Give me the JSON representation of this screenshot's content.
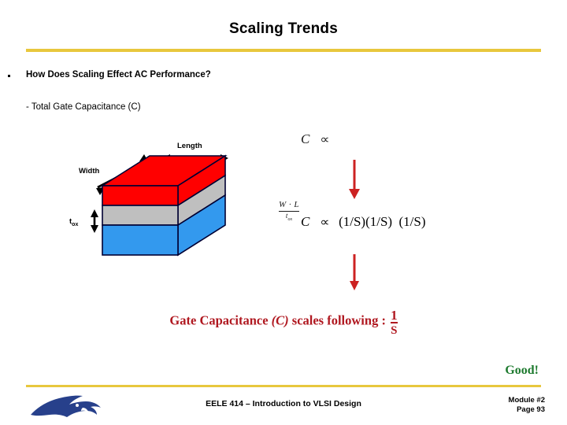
{
  "slide": {
    "title": "Scaling Trends",
    "accent_color": "#e8c73d",
    "background": "#ffffff"
  },
  "content": {
    "bullet": "How Does Scaling Effect AC Performance?",
    "sub_bullet": "- Total Gate Capacitance  (C)"
  },
  "diagram": {
    "label_length": "Length",
    "label_width": "Width",
    "label_tox": "t",
    "label_tox_sub": "ox",
    "layer_top_color": "#ff0000",
    "layer_mid_color": "#bfbfbf",
    "layer_bottom_color": "#3399ee",
    "outline_color": "#000033"
  },
  "equations": {
    "eq1_lhs": "C",
    "eq1_prop": "∝",
    "frac_wl_num": "W · L",
    "frac_wl_den": "t",
    "frac_wl_den_sub": "ox",
    "eq2_lhs": "C",
    "eq2_prop": "∝",
    "eq2_num": "(1/S)(1/S)",
    "eq2_den": "(1/S)",
    "arrow_color": "#cc2222"
  },
  "conclusion": {
    "text_part1": "Gate Capacitance ",
    "text_italic": "(C)",
    "text_part2": " scales following : ",
    "fraction_num": "1",
    "fraction_den": "S",
    "color": "#b01820",
    "good_label": "Good!",
    "good_color": "#1d7a2e"
  },
  "footer": {
    "course": "EELE 414 – Introduction to VLSI Design",
    "module": "Module #2",
    "page": "Page 93",
    "logo_color": "#27408b"
  }
}
